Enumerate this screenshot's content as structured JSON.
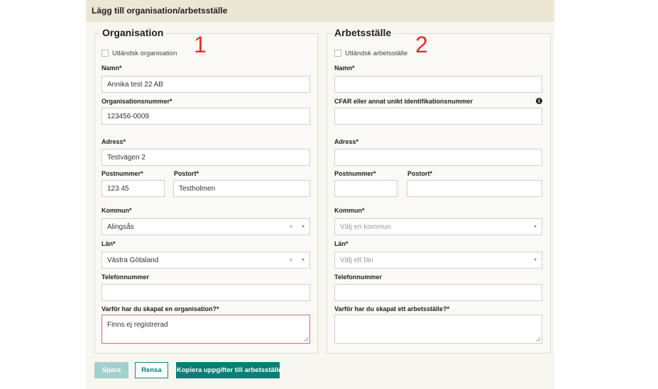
{
  "dialog": {
    "title": "Lägg till organisation/arbetsställe"
  },
  "organisation": {
    "heading": "Organisation",
    "marker": "1",
    "foreign_label": "Utländsk organisation",
    "name_label": "Namn*",
    "name_value": "Annika test 22 AB",
    "orgnr_label": "Organisationsnummer*",
    "orgnr_value": "123456-0009",
    "address_label": "Adress*",
    "address_value": "Testvägen 2",
    "postal_label": "Postnummer*",
    "postal_value": "123 45",
    "city_label": "Postort*",
    "city_value": "Testholmen",
    "municipality_label": "Kommun*",
    "municipality_value": "Alingsås",
    "county_label": "Län*",
    "county_value": "Västra Götaland",
    "phone_label": "Telefonnummer",
    "phone_value": "",
    "reason_label": "Varför har du skapat en organisation?*",
    "reason_value": "Finns ej registrerad"
  },
  "workplace": {
    "heading": "Arbetsställe",
    "marker": "2",
    "foreign_label": "Utländsk arbetsställe",
    "name_label": "Namn*",
    "cfar_label": "CFAR eller annat unikt identifikationsnummer",
    "address_label": "Adress*",
    "postal_label": "Postnummer*",
    "city_label": "Postort*",
    "municipality_label": "Kommun*",
    "municipality_placeholder": "Välj en kommun",
    "county_label": "Län*",
    "county_placeholder": "Välj ett län",
    "phone_label": "Telefonnummer",
    "reason_label": "Varför har du skapat ett arbetsställe?*"
  },
  "icons": {
    "clear": "close-icon",
    "dropdown": "chevron-down-icon",
    "info": "info-icon"
  },
  "glyphs": {
    "clear": "×",
    "arrow": "▾",
    "info": "i"
  },
  "buttons": {
    "save": "Spara",
    "clear": "Rensa",
    "copy": "Kopiera uppgifter till arbetsställe"
  },
  "colors": {
    "accent": "#0b7e76",
    "header_bg": "#ece6d5",
    "marker_red": "#e5312b",
    "save_disabled": "#a2d1cd"
  }
}
